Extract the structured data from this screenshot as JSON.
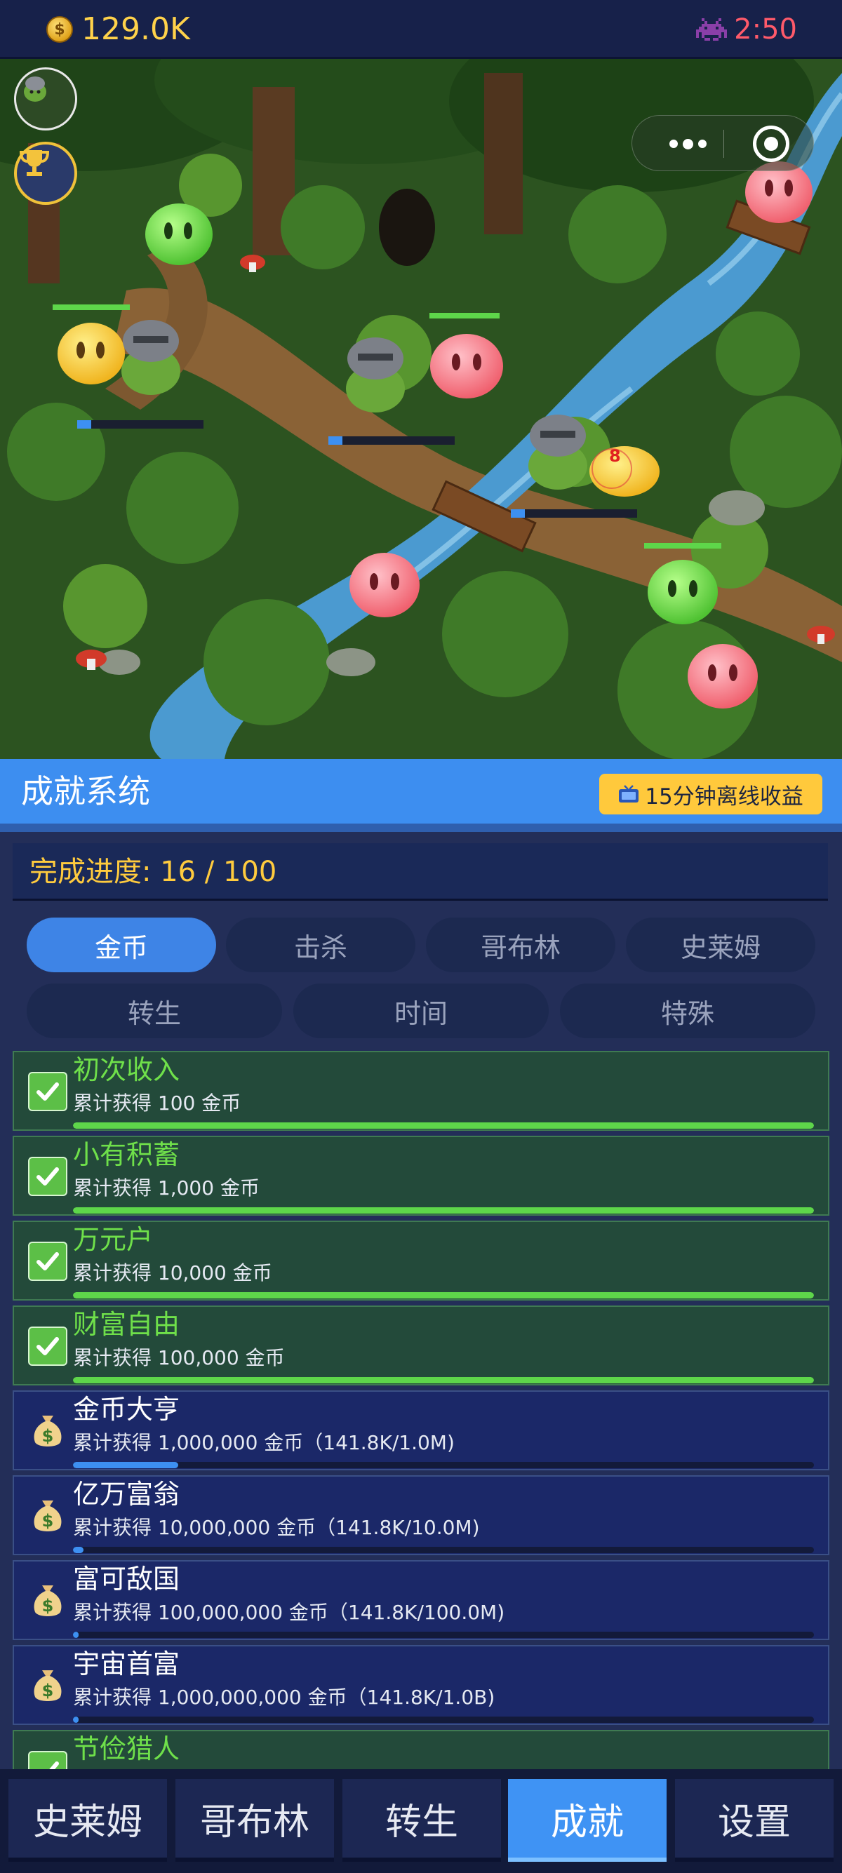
{
  "topbar": {
    "coin_icon": "coin-icon",
    "coin_symbol": "$",
    "gold": "129.0K",
    "timer_icon": "space-invader-icon",
    "timer": "2:50"
  },
  "scene": {
    "avatar_icon": "goblin-avatar-icon",
    "trophy_icon": "trophy-icon",
    "monster_label": "8"
  },
  "panel": {
    "title": "成就系统",
    "offline_button": "15分钟离线收益",
    "progress_label": "完成进度: 16 / 100"
  },
  "tabs_row1": [
    {
      "label": "金币",
      "active": true
    },
    {
      "label": "击杀",
      "active": false
    },
    {
      "label": "哥布林",
      "active": false
    },
    {
      "label": "史莱姆",
      "active": false
    }
  ],
  "tabs_row2": [
    {
      "label": "转生",
      "active": false
    },
    {
      "label": "时间",
      "active": false
    },
    {
      "label": "特殊",
      "active": false
    }
  ],
  "achievements": [
    {
      "name": "初次收入",
      "desc": "累计获得 100 金币",
      "done": true,
      "progress": 1.0,
      "icon": "checkmark-icon"
    },
    {
      "name": "小有积蓄",
      "desc": "累计获得 1,000 金币",
      "done": true,
      "progress": 1.0,
      "icon": "checkmark-icon"
    },
    {
      "name": "万元户",
      "desc": "累计获得 10,000 金币",
      "done": true,
      "progress": 1.0,
      "icon": "checkmark-icon"
    },
    {
      "name": "财富自由",
      "desc": "累计获得 100,000 金币",
      "done": true,
      "progress": 1.0,
      "icon": "checkmark-icon"
    },
    {
      "name": "金币大亨",
      "desc": "累计获得 1,000,000 金币（141.8K/1.0M)",
      "done": false,
      "progress": 0.1418,
      "icon": "money-bag-icon"
    },
    {
      "name": "亿万富翁",
      "desc": "累计获得 10,000,000 金币（141.8K/10.0M)",
      "done": false,
      "progress": 0.01418,
      "icon": "money-bag-icon"
    },
    {
      "name": "富可敌国",
      "desc": "累计获得 100,000,000 金币（141.8K/100.0M)",
      "done": false,
      "progress": 0.001418,
      "icon": "money-bag-icon"
    },
    {
      "name": "宇宙首富",
      "desc": "累计获得 1,000,000,000 金币（141.8K/1.0B)",
      "done": false,
      "progress": 0.0001418,
      "icon": "money-bag-icon"
    },
    {
      "name": "节俭猎人",
      "desc": "",
      "done": true,
      "progress": 1.0,
      "icon": "checkmark-icon"
    }
  ],
  "bottom_nav": [
    {
      "label": "史莱姆",
      "active": false
    },
    {
      "label": "哥布林",
      "active": false
    },
    {
      "label": "转生",
      "active": false
    },
    {
      "label": "成就",
      "active": true
    },
    {
      "label": "设置",
      "active": false
    }
  ],
  "colors": {
    "accent_blue": "#3e84e6",
    "gold_text": "#ffd24a",
    "done_green": "#6fe04a",
    "timer_red": "#ff5a6a"
  }
}
